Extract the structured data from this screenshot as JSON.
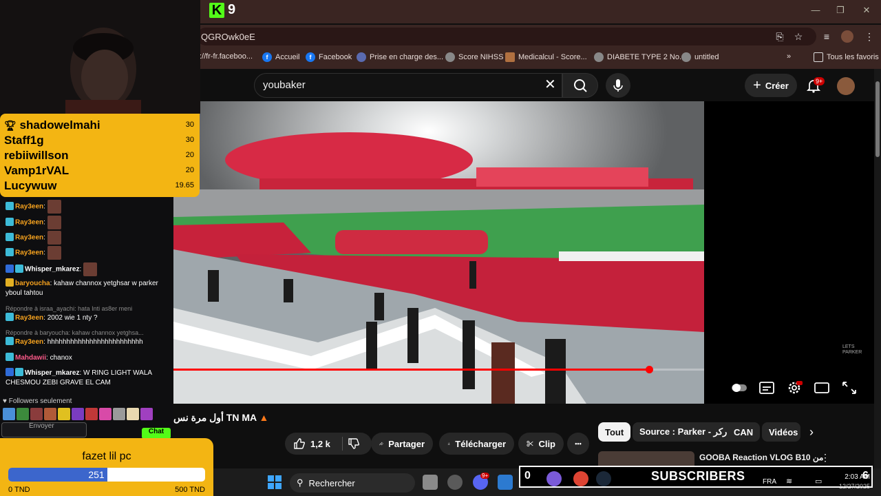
{
  "kick": {
    "logo": "K",
    "viewer_count": "9"
  },
  "browser": {
    "url": "QGROwk0eE",
    "bookmarks": [
      {
        "label": "://fr-fr.faceboo...",
        "icon": "facebook-icon"
      },
      {
        "label": "Accueil",
        "icon": "facebook-icon"
      },
      {
        "label": "Facebook",
        "icon": "facebook-icon"
      },
      {
        "label": "Prise en charge des...",
        "icon": "page-icon"
      },
      {
        "label": "Score NIHSS",
        "icon": "globe-icon"
      },
      {
        "label": "Medicalcul - Score...",
        "icon": "page-icon"
      },
      {
        "label": "DIABETE TYPE 2 No...",
        "icon": "globe-icon"
      },
      {
        "label": "untitled",
        "icon": "globe-icon"
      }
    ],
    "all_favorites": "Tous les favoris",
    "more": "»"
  },
  "youtube": {
    "search_value": "youbaker",
    "create_label": "Créer",
    "notifications_badge": "9+",
    "video_title": "أول مرة نس TN MA",
    "progress": 0.896,
    "actions": {
      "likes": "1,2 k",
      "share": "Partager",
      "download": "Télécharger",
      "clip": "Clip",
      "more": "•••"
    },
    "chips": [
      "Tout",
      "Source : Parker - باركر",
      "CAN",
      "Vidéos"
    ],
    "recommendation_title": "GOOBA Reaction VLOG B10 من",
    "watermark": "LETS\nPARKER"
  },
  "leaderboard": [
    {
      "name": "shadowelmahi",
      "score": "30"
    },
    {
      "name": "Staff1g",
      "score": "30"
    },
    {
      "name": "rebiiwillson",
      "score": "20"
    },
    {
      "name": "Vamp1rVAL",
      "score": "20"
    },
    {
      "name": "Lucywuw",
      "score": "19.65"
    }
  ],
  "chat": {
    "messages": [
      {
        "user": "Ray3een",
        "text": ""
      },
      {
        "user": "Ray3een",
        "text": ""
      },
      {
        "user": "Ray3een",
        "text": ""
      },
      {
        "user": "Ray3een",
        "text": ""
      },
      {
        "user": "Whisper_mkarez",
        "text": ""
      },
      {
        "user": "baryoucha",
        "text": "kahaw channox yetghsar w parker yboul tahtou"
      },
      {
        "reply": "Répondre à israa_ayachi: hata Inti as8er meni",
        "user": "Ray3een",
        "text": "2002 wie 1 nty ?"
      },
      {
        "reply": "Répondre à baryoucha: kahaw channox yetghsa...",
        "user": "Ray3een",
        "text": "hhhhhhhhhhhhhhhhhhhhhhhhh"
      },
      {
        "user": "Mahdawii",
        "text": "chanox"
      },
      {
        "user": "Whisper_mkarez",
        "text": "W RING LIGHT WALA CHESMOU ZEBI GRAVE EL CAM"
      }
    ],
    "followers_only": "Followers seulement",
    "send_placeholder": "Envoyer",
    "chat_button": "Chat"
  },
  "goal": {
    "title": "fazet lil pc",
    "current": "251",
    "current_value": 251,
    "max_value": 500,
    "min_label": "0 TND",
    "max_label": "500 TND"
  },
  "taskbar": {
    "search": "Rechercher",
    "subscribers_count": "0",
    "subscribers_label": "SUBSCRIBERS",
    "subscribers_right": "6",
    "lang": "FRA",
    "time": "2:03 AM",
    "date": "12/27/2025",
    "discord_badge": "9+"
  },
  "colors": {
    "kick_green": "#53fc18",
    "widget_yellow": "#f3b513",
    "goal_blue": "#3c66cc",
    "yt_red": "#ff0000"
  }
}
